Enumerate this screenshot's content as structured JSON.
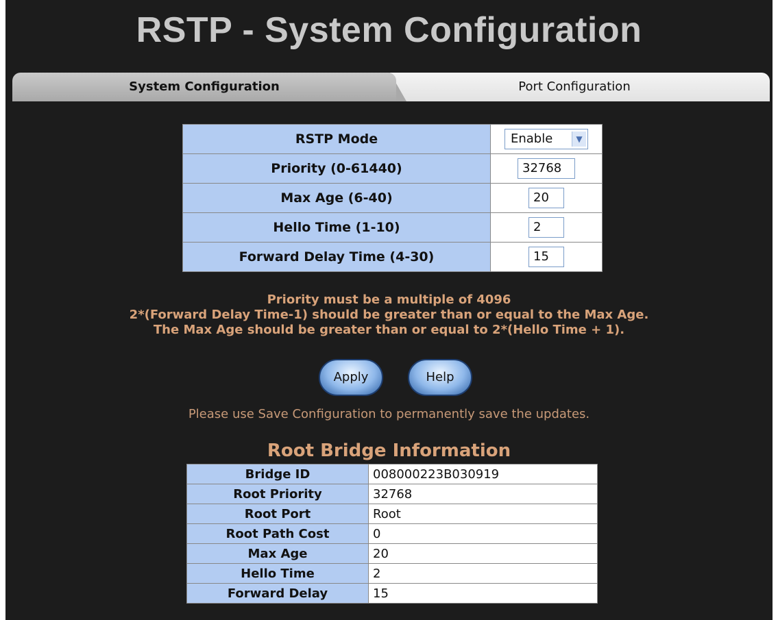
{
  "page_title": "RSTP - System Configuration",
  "tabs": [
    {
      "label": "System Configuration",
      "active": true
    },
    {
      "label": "Port Configuration",
      "active": false
    }
  ],
  "config": {
    "rstp_mode_label": "RSTP Mode",
    "rstp_mode_value": "Enable",
    "priority_label": "Priority (0-61440)",
    "priority_value": "32768",
    "max_age_label": "Max Age (6-40)",
    "max_age_value": "20",
    "hello_time_label": "Hello Time (1-10)",
    "hello_time_value": "2",
    "forward_delay_label": "Forward Delay Time (4-30)",
    "forward_delay_value": "15"
  },
  "notes": [
    "Priority must be a multiple of 4096",
    "2*(Forward Delay Time-1) should be greater than or equal to the Max Age.",
    "The Max Age should be greater than or equal to 2*(Hello Time + 1)."
  ],
  "buttons": {
    "apply": "Apply",
    "help": "Help"
  },
  "save_note": "Please use Save Configuration to permanently save the updates.",
  "root_bridge": {
    "title": "Root Bridge Information",
    "rows": [
      {
        "label": "Bridge ID",
        "value": "008000223B030919"
      },
      {
        "label": "Root Priority",
        "value": "32768"
      },
      {
        "label": "Root Port",
        "value": "Root"
      },
      {
        "label": "Root Path Cost",
        "value": "0"
      },
      {
        "label": "Max Age",
        "value": "20"
      },
      {
        "label": "Hello Time",
        "value": "2"
      },
      {
        "label": "Forward Delay",
        "value": "15"
      }
    ]
  },
  "colors": {
    "background": "#1c1c1c",
    "label_cell": "#b3ccf2",
    "note_text": "#d9a37a"
  }
}
